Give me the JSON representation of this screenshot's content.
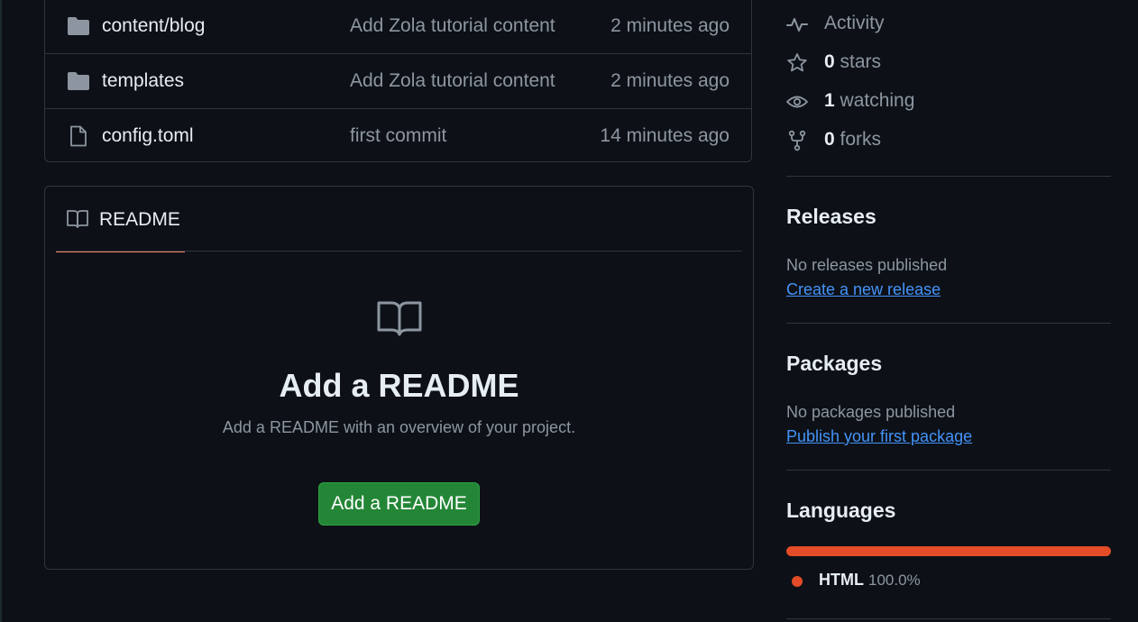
{
  "files": [
    {
      "name": "content/blog",
      "type": "folder",
      "commit": "Add Zola tutorial content",
      "time": "2 minutes ago"
    },
    {
      "name": "templates",
      "type": "folder",
      "commit": "Add Zola tutorial content",
      "time": "2 minutes ago"
    },
    {
      "name": "config.toml",
      "type": "file",
      "commit": "first commit",
      "time": "14 minutes ago"
    }
  ],
  "readme": {
    "tab_label": "README",
    "title": "Add a README",
    "subtitle": "Add a README with an overview of your project.",
    "button_label": "Add a README"
  },
  "about": {
    "activity_label": "Activity",
    "stars_count": "0",
    "stars_label": "stars",
    "watching_count": "1",
    "watching_label": "watching",
    "forks_count": "0",
    "forks_label": "forks"
  },
  "releases": {
    "title": "Releases",
    "empty_text": "No releases published",
    "link": "Create a new release"
  },
  "packages": {
    "title": "Packages",
    "empty_text": "No packages published",
    "link": "Publish your first package"
  },
  "languages": {
    "title": "Languages",
    "items": [
      {
        "name": "HTML",
        "percent": "100.0%",
        "color": "#e34c26"
      }
    ]
  },
  "colors": {
    "background": "#0d1117",
    "border": "#30363d",
    "accent_green": "#238636",
    "link_blue": "#4493f8",
    "tab_underline": "#f78166"
  }
}
